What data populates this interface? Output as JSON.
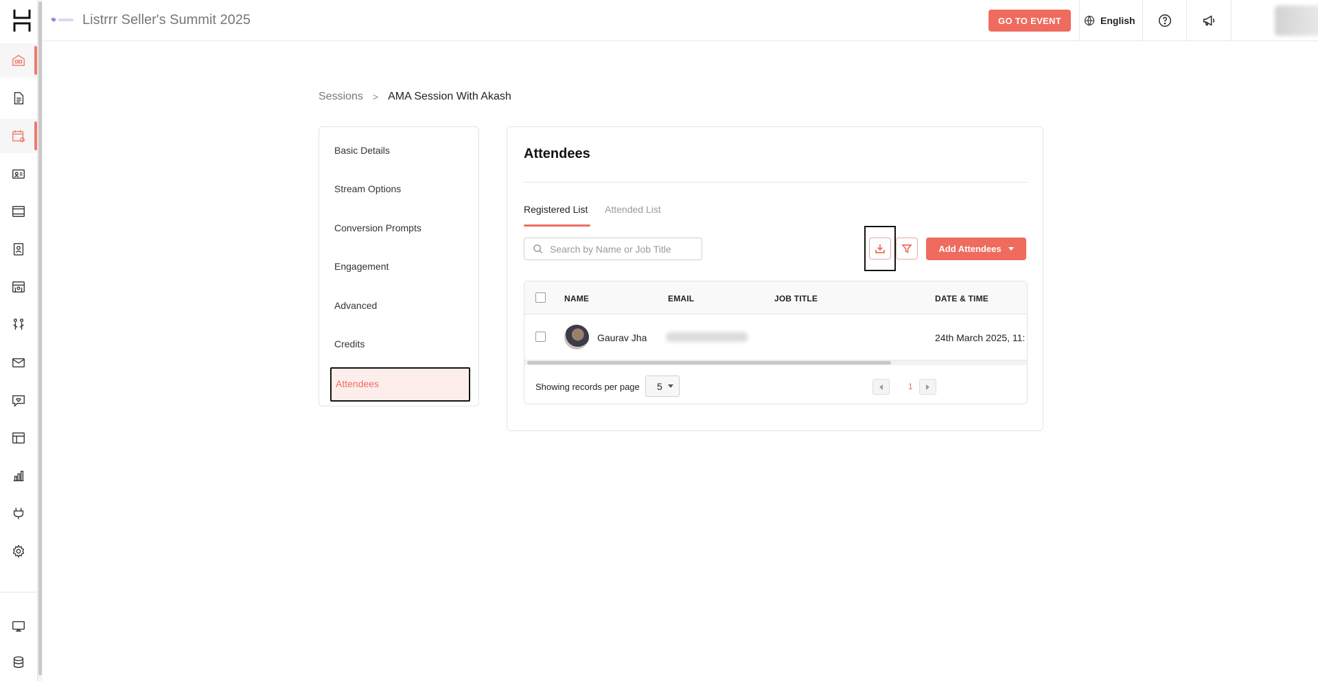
{
  "header": {
    "event_title": "Listrrr Seller's Summit 2025",
    "go_to_event_label": "GO TO EVENT",
    "language": "English"
  },
  "breadcrumb": {
    "parent": "Sessions",
    "separator": ">",
    "current": "AMA Session With Akash"
  },
  "side_menu": {
    "items": [
      {
        "label": "Basic Details"
      },
      {
        "label": "Stream Options"
      },
      {
        "label": "Conversion Prompts"
      },
      {
        "label": "Engagement"
      },
      {
        "label": "Advanced"
      },
      {
        "label": "Credits"
      },
      {
        "label": "Attendees"
      }
    ],
    "active": "Attendees"
  },
  "panel": {
    "title": "Attendees",
    "tabs": [
      {
        "label": "Registered List"
      },
      {
        "label": "Attended List"
      }
    ],
    "active_tab": "Registered List",
    "search_placeholder": "Search by Name or Job Title",
    "add_attendees_label": "Add Attendees"
  },
  "table": {
    "columns": [
      "NAME",
      "EMAIL",
      "JOB TITLE",
      "DATE & TIME"
    ],
    "rows": [
      {
        "name": "Gaurav Jha",
        "email": "",
        "job_title": "",
        "date_time": "24th March 2025, 11:"
      }
    ],
    "records_label": "Showing records per page",
    "per_page": "5",
    "current_page": "1"
  },
  "colors": {
    "accent": "#ef6b5e",
    "active_bg": "#fdeeec"
  },
  "icons": {
    "rail": [
      "home-icon",
      "document-icon",
      "calendar-icon",
      "id-card-icon",
      "media-icon",
      "badge-icon",
      "booth-icon",
      "networking-icon",
      "mail-icon",
      "chat-heart-icon",
      "layout-icon",
      "analytics-icon",
      "plugin-icon",
      "settings-icon",
      "screen-icon",
      "database-icon"
    ]
  }
}
